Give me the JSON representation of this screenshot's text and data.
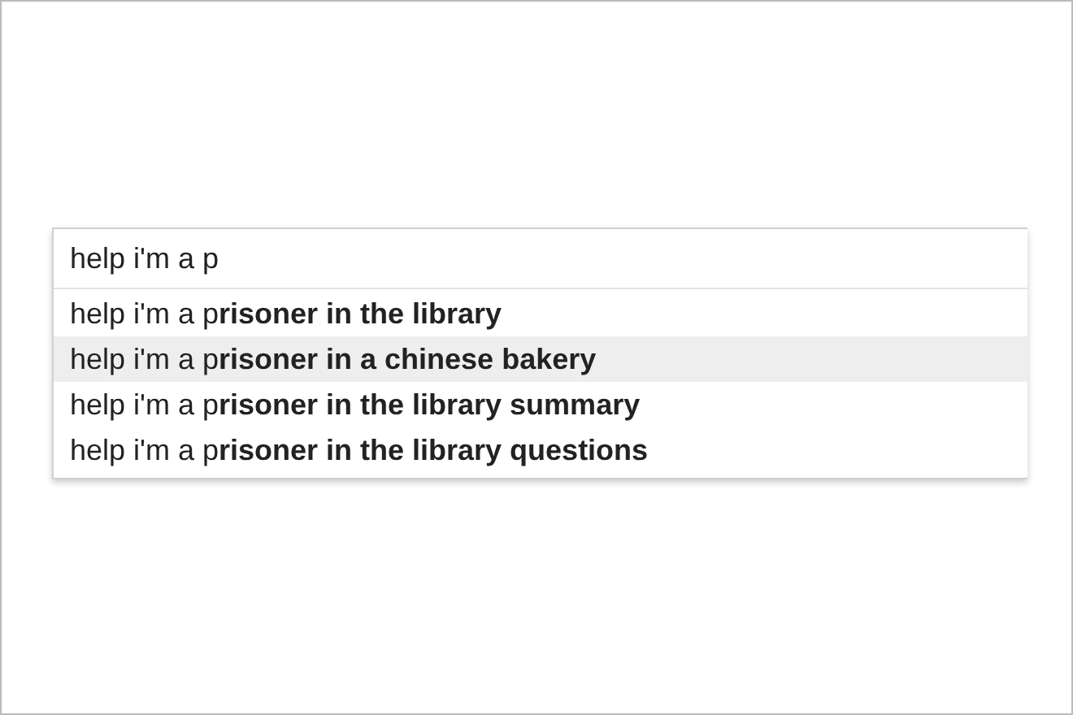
{
  "search": {
    "value": "help i'm a p"
  },
  "suggestions": [
    {
      "text": "help i'm a p**risoner in the library**",
      "selected": false
    },
    {
      "text": "help i'm a p**risoner in a chinese bakery**",
      "selected": true
    },
    {
      "text": "help i'm a p**risoner in the library summary**",
      "selected": false
    },
    {
      "text": "help i'm a p**risoner in the library questions**",
      "selected": false
    }
  ]
}
